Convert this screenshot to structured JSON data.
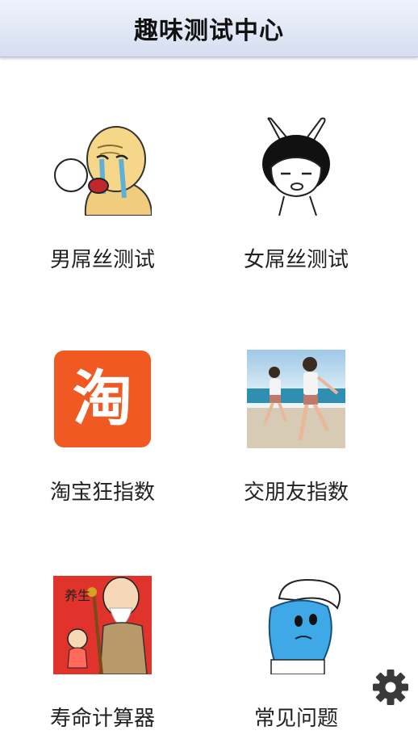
{
  "header": {
    "title": "趣味测试中心"
  },
  "grid": {
    "items": [
      {
        "label": "男屌丝测试",
        "icon": "crying-bald-man-icon"
      },
      {
        "label": "女屌丝测试",
        "icon": "bunny-ears-girl-icon"
      },
      {
        "label": "淘宝狂指数",
        "icon": "taobao-icon",
        "glyph": "淘",
        "color": "#f05a22"
      },
      {
        "label": "交朋友指数",
        "icon": "kids-running-beach-photo"
      },
      {
        "label": "寿命计算器",
        "icon": "longevity-god-icon",
        "badge": "养生"
      },
      {
        "label": "常见问题",
        "icon": "blue-smurf-icon"
      }
    ]
  },
  "settings": {
    "icon": "gear-icon"
  }
}
